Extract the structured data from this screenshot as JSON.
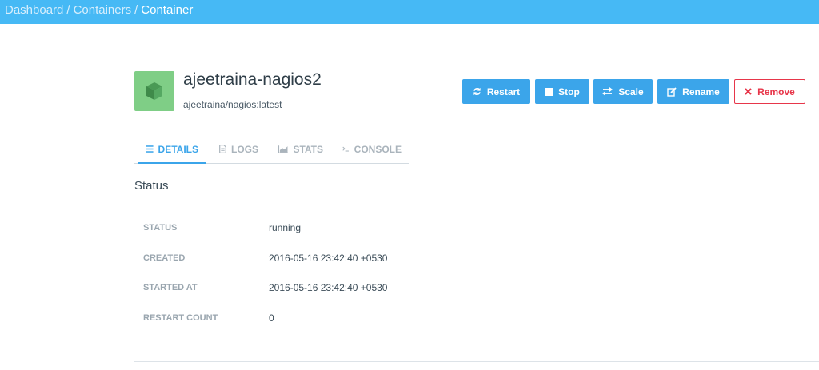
{
  "breadcrumb": {
    "items": [
      "Dashboard",
      "Containers"
    ],
    "separator": "/",
    "current": "Container"
  },
  "container": {
    "name": "ajeetraina-nagios2",
    "image": "ajeetraina/nagios:latest",
    "icon": "cube-icon"
  },
  "actions": {
    "restart": "Restart",
    "stop": "Stop",
    "scale": "Scale",
    "rename": "Rename",
    "remove": "Remove"
  },
  "tabs": {
    "details": "DETAILS",
    "logs": "LOGS",
    "stats": "STATS",
    "console": "CONSOLE",
    "active": "DETAILS"
  },
  "status_section": {
    "title": "Status",
    "rows": [
      {
        "label": "STATUS",
        "value": "running"
      },
      {
        "label": "CREATED",
        "value": "2016-05-16 23:42:40 +0530"
      },
      {
        "label": "STARTED AT",
        "value": "2016-05-16 23:42:40 +0530"
      },
      {
        "label": "RESTART COUNT",
        "value": "0"
      }
    ]
  },
  "colors": {
    "topbar": "#46b9f5",
    "primary": "#3ba5ea",
    "danger": "#e7364a",
    "icon_bg": "#7fce86"
  }
}
